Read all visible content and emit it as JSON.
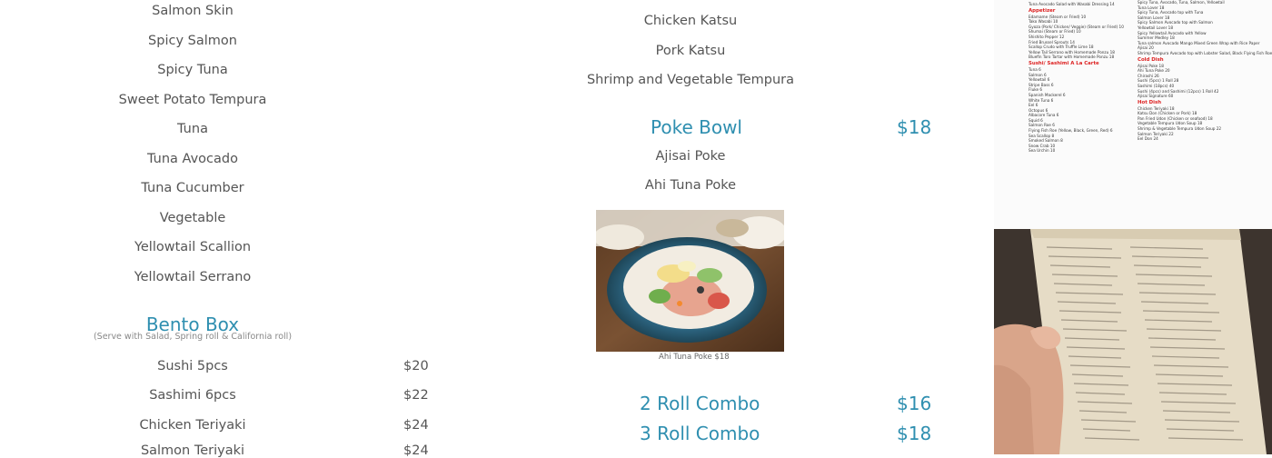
{
  "left_column": {
    "items": [
      "Salmon Skin",
      "Spicy Salmon",
      "Spicy Tuna",
      "Sweet Potato Tempura",
      "Tuna",
      "Tuna Avocado",
      "Tuna Cucumber",
      "Vegetable",
      "Yellowtail Scallion",
      "Yellowtail Serrano"
    ],
    "bento": {
      "title": "Bento Box",
      "note": "(Serve with Salad, Spring roll & California roll)",
      "items": [
        {
          "name": "Sushi 5pcs",
          "price": "$20"
        },
        {
          "name": "Sashimi 6pcs",
          "price": "$22"
        },
        {
          "name": "Chicken Teriyaki",
          "price": "$24"
        },
        {
          "name": "Salmon Teriyaki",
          "price": "$24"
        }
      ]
    }
  },
  "middle_column": {
    "items_top": [
      "Chicken Katsu",
      "Pork Katsu",
      "Shrimp and Vegetable Tempura"
    ],
    "poke": {
      "title": "Poke Bowl",
      "price": "$18",
      "items": [
        "Ajisai Poke",
        "Ahi Tuna Poke"
      ],
      "photo_caption": "Ahi Tuna Poke $18"
    },
    "combos": [
      {
        "title": "2 Roll Combo",
        "price": "$16"
      },
      {
        "title": "3 Roll Combo",
        "price": "$18"
      }
    ]
  },
  "right_column": {
    "menu_left": [
      {
        "t": "line",
        "text": "Tuna Avocado Salad with Wasabi Dressing   14"
      },
      {
        "t": "head",
        "text": "Appetizer"
      },
      {
        "t": "line",
        "text": "Edamame (Steam or Fried)   10"
      },
      {
        "t": "line",
        "text": "Tako Wasabi   10"
      },
      {
        "t": "line",
        "text": "Gyoza (Pork/ Chicken/ Veggie) (Steam or Fried)   10"
      },
      {
        "t": "line",
        "text": "Shumai (Steam or Fried)   10"
      },
      {
        "t": "line",
        "text": "Shishito Pepper   12"
      },
      {
        "t": "line",
        "text": "Fried Brussel Sprouts   14"
      },
      {
        "t": "line",
        "text": "Scallop Crudo with Truffle Lime   18"
      },
      {
        "t": "line",
        "text": "Yellow Tail Serrano with Homemade Ponzu   18"
      },
      {
        "t": "line",
        "text": "Bluefin Toro Tartar with Homemade Ponzu   18"
      },
      {
        "t": "head",
        "text": "Sushi/ Sashimi A La Carte"
      },
      {
        "t": "line",
        "text": "Tuna   6"
      },
      {
        "t": "line",
        "text": "Salmon   6"
      },
      {
        "t": "line",
        "text": "Yellowtail   6"
      },
      {
        "t": "line",
        "text": "Stripe Bass   6"
      },
      {
        "t": "line",
        "text": "Fluke   6"
      },
      {
        "t": "line",
        "text": "Spanish Mackerel   6"
      },
      {
        "t": "line",
        "text": "White Tuna   6"
      },
      {
        "t": "line",
        "text": "Eel   6"
      },
      {
        "t": "line",
        "text": "Octopus   6"
      },
      {
        "t": "line",
        "text": "Albacore Tuna   6"
      },
      {
        "t": "line",
        "text": "Squid   6"
      },
      {
        "t": "line",
        "text": "Salmon Roe   6"
      },
      {
        "t": "line",
        "text": "Flying Fish Roe (Yellow, Black, Green, Red)   6"
      },
      {
        "t": "line",
        "text": "Sea Scallop   8"
      },
      {
        "t": "line",
        "text": "Smoked Salmon   8"
      },
      {
        "t": "line",
        "text": "Snow Crab   10"
      },
      {
        "t": "line",
        "text": "Sea Urchin   10"
      }
    ],
    "menu_right": [
      {
        "t": "line",
        "text": "Spicy Tuna, Avocado, Tuna, Salmon, Yellowtail"
      },
      {
        "t": "line",
        "text": "Tuna Lover   18"
      },
      {
        "t": "line",
        "text": "Spicy Tuna, Avocado top with Tuna"
      },
      {
        "t": "line",
        "text": "Salmon Lover   18"
      },
      {
        "t": "line",
        "text": "Spicy Salmon Avocado top with Salmon"
      },
      {
        "t": "line",
        "text": "Yellowtail Lover   18"
      },
      {
        "t": "line",
        "text": "Spicy Yellowtail Avocado with Yellow"
      },
      {
        "t": "line",
        "text": "Summer Medley   18"
      },
      {
        "t": "line",
        "text": "Tuna salmon Avocado Mango Mixed Green Wrap with Rice Paper"
      },
      {
        "t": "line",
        "text": "Ajisai   20"
      },
      {
        "t": "line",
        "text": "Shrimp Tempura Avocado top with Lobster Salad, Black Flying Fish Roe"
      },
      {
        "t": "head",
        "text": "Cold Dish"
      },
      {
        "t": "line",
        "text": "Ajisai Poke   18"
      },
      {
        "t": "line",
        "text": "Ahi Tuna Poke   20"
      },
      {
        "t": "line",
        "text": "Chirashi   26"
      },
      {
        "t": "line",
        "text": "Sushi (5pcs) 1 Roll   28"
      },
      {
        "t": "line",
        "text": "Sashimi (18pcs)   40"
      },
      {
        "t": "line",
        "text": "Sushi (4pcs) and Sashimi (12pcs) 1 Roll   42"
      },
      {
        "t": "line",
        "text": "Ajisai Signature   60"
      },
      {
        "t": "head",
        "text": "Hot Dish"
      },
      {
        "t": "line",
        "text": "Chicken Teriyaki   18"
      },
      {
        "t": "line",
        "text": "Katsu Don (Chicken or Pork)   18"
      },
      {
        "t": "line",
        "text": "Pan Fried Udon (Chicken or seafood)   18"
      },
      {
        "t": "line",
        "text": "Vegetable Tempura Udon Soup   18"
      },
      {
        "t": "line",
        "text": "Shrimp & Vegetable Tempura Udon Soup   22"
      },
      {
        "t": "line",
        "text": "Salmon Teriyaki   22"
      },
      {
        "t": "line",
        "text": "Eel Don   24"
      }
    ]
  },
  "colors": {
    "accent": "#2f8fb0",
    "text": "#555555",
    "menu_heading": "#dd2222"
  }
}
